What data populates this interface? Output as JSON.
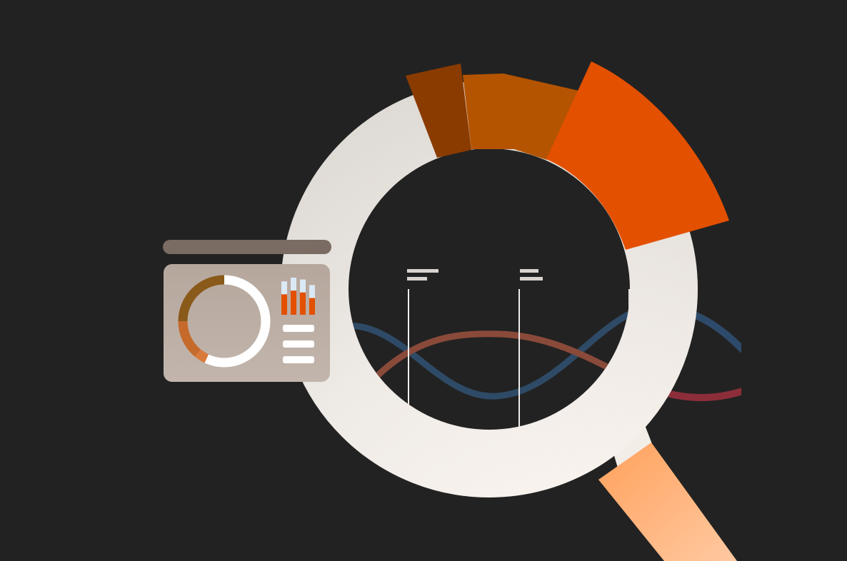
{
  "colors": {
    "background": "#222222",
    "ring_light": "#ece8e3",
    "ring_shadow": "#d5d1cc",
    "ring_warm": "#fbf4ee",
    "handle_start": "#ffa460",
    "handle_end": "#ffc8a0",
    "segment_dark": "#8c3c00",
    "segment_mid": "#b65400",
    "segment_bright": "#e35000",
    "wave_blue": "#2e4a66",
    "wave_red": "#8c2e38",
    "card_bar": "#7b6c64",
    "card_body": "#baaca3",
    "card_accent_brown": "#8a5a1a",
    "card_accent_orange": "#c66a2c",
    "card_bar_orange": "#e35000",
    "card_bar_cap": "#dbe9f5",
    "white": "#ffffff"
  },
  "icons": {
    "magnifier": "magnifier-icon",
    "dashboard_card": "dashboard-card-icon",
    "donut": "donut-chart-icon",
    "bars": "bar-chart-icon"
  },
  "card_donut_fractions": [
    0.25,
    0.14,
    0.04,
    0.57
  ],
  "card_bar_levels": [
    0.55,
    0.65,
    0.6,
    0.45
  ]
}
